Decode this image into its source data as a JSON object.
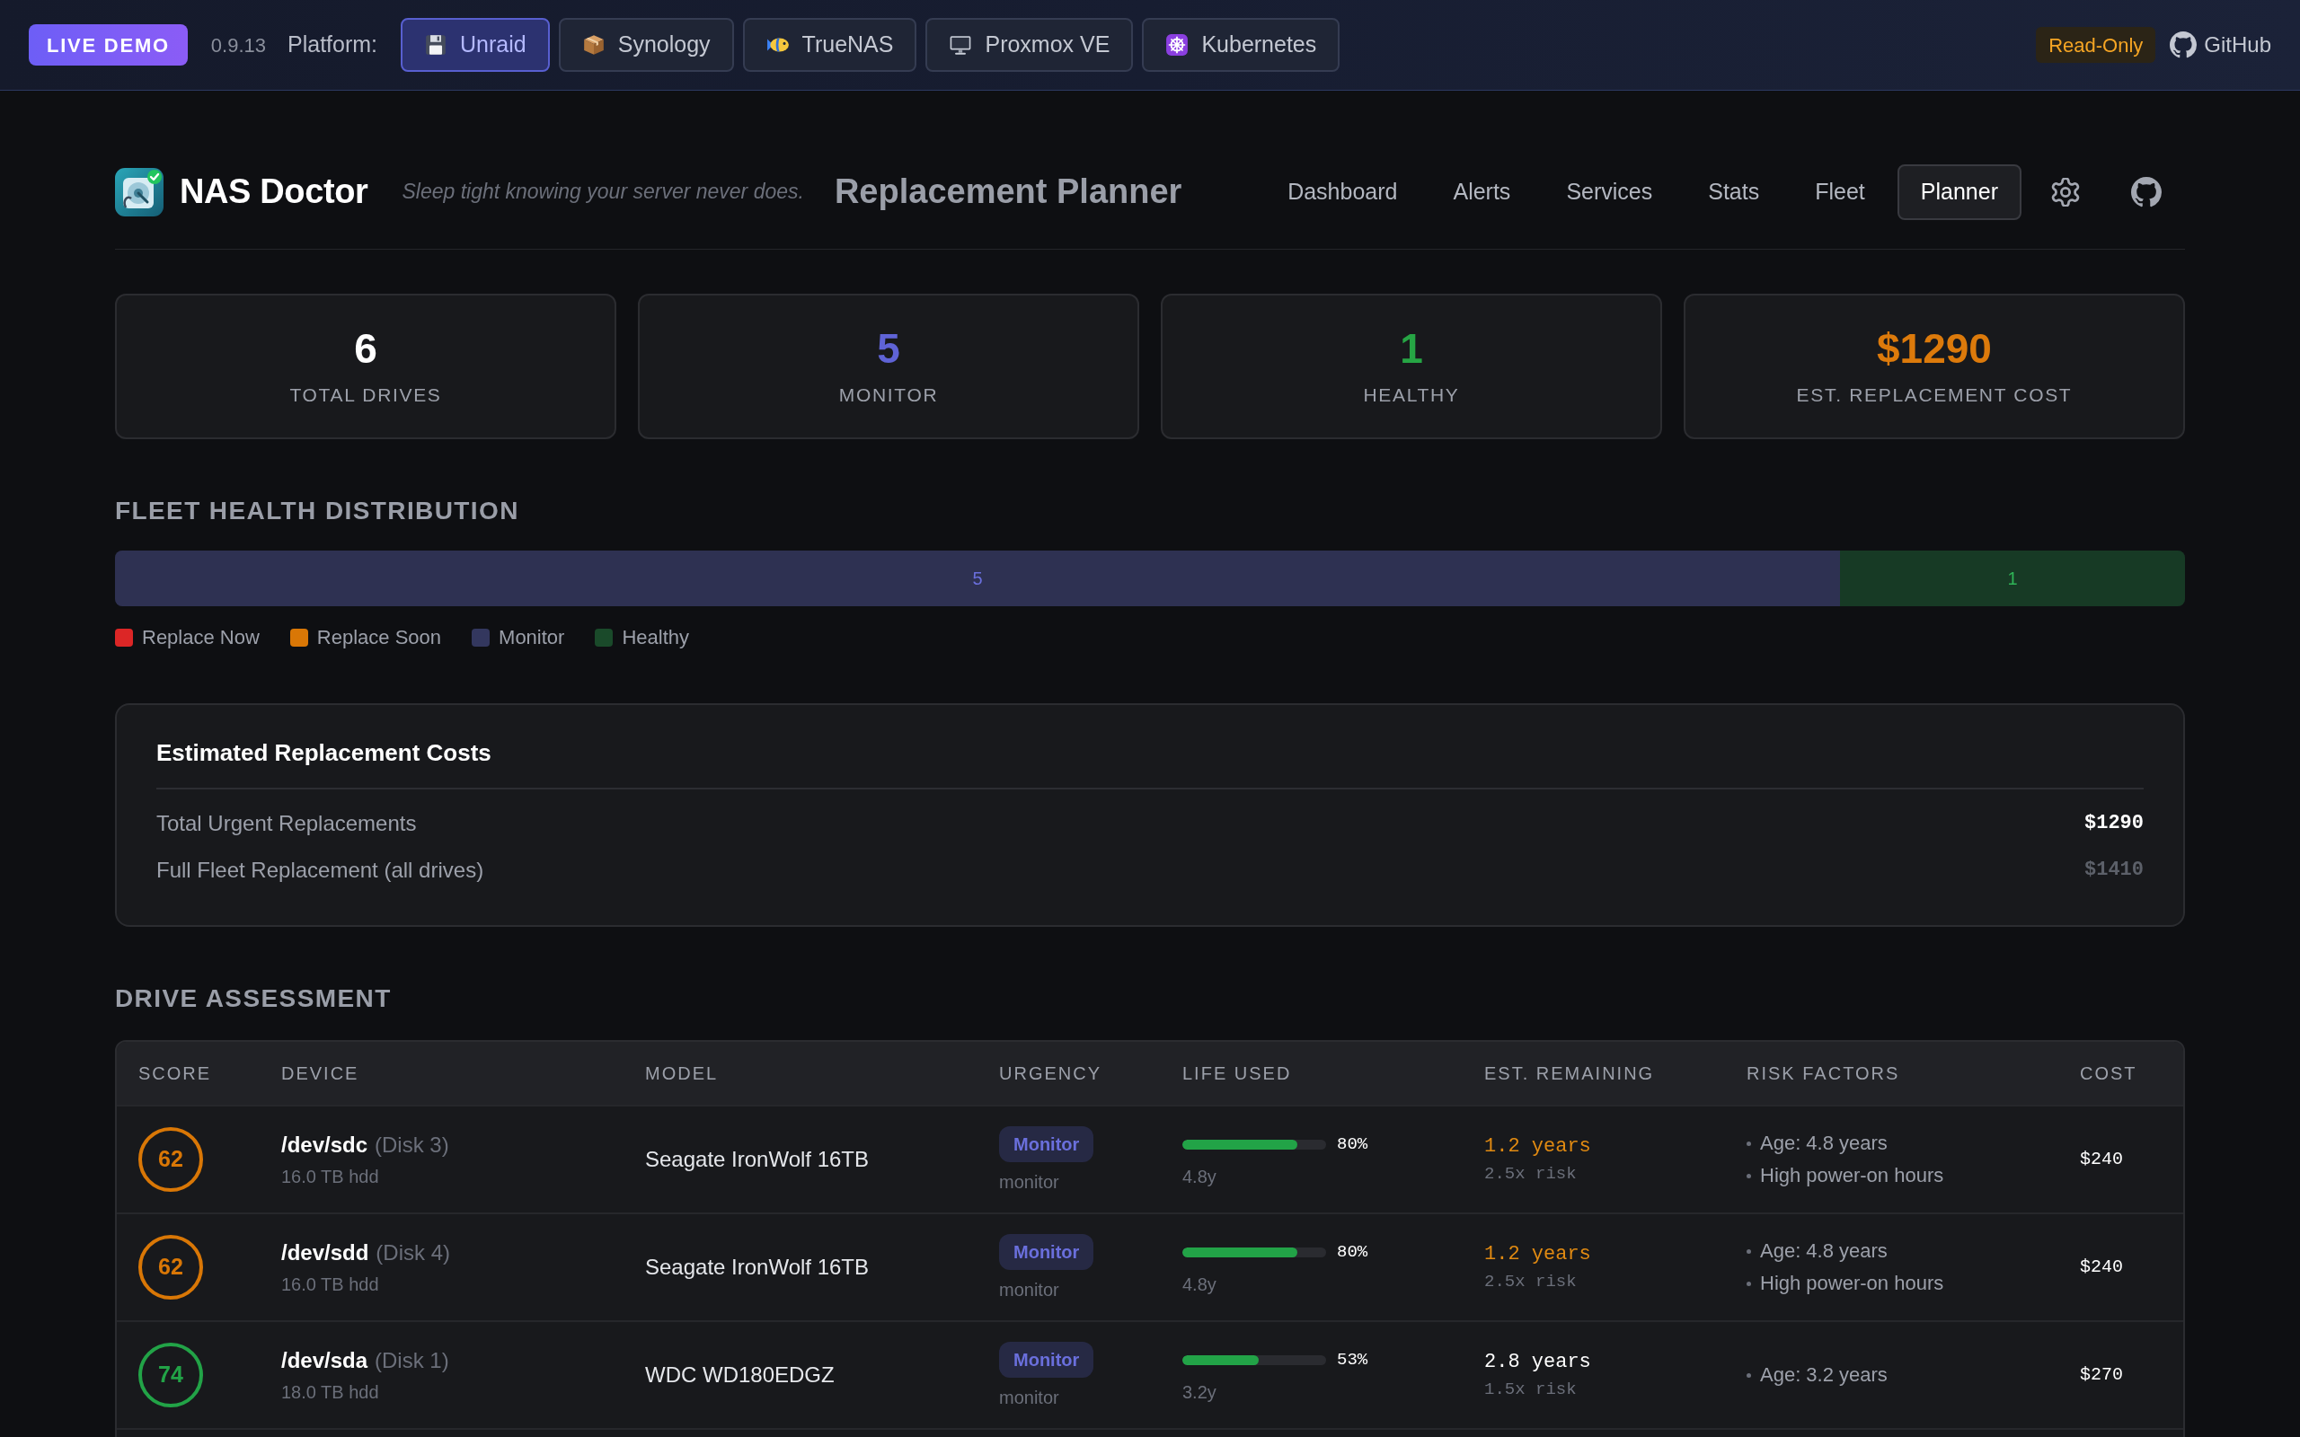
{
  "top_bar": {
    "demo_badge": "LIVE DEMO",
    "version": "0.9.13",
    "platform_label": "Platform:",
    "platforms": [
      {
        "label": "Unraid",
        "selected": true
      },
      {
        "label": "Synology",
        "selected": false
      },
      {
        "label": "TrueNAS",
        "selected": false
      },
      {
        "label": "Proxmox VE",
        "selected": false
      },
      {
        "label": "Kubernetes",
        "selected": false
      }
    ],
    "mode_badge": "Read-Only",
    "github_link": "GitHub"
  },
  "header": {
    "app_name": "NAS Doctor",
    "tagline": "Sleep tight knowing your server never does.",
    "page_title": "Replacement Planner",
    "nav": [
      {
        "label": "Dashboard",
        "selected": false
      },
      {
        "label": "Alerts",
        "selected": false
      },
      {
        "label": "Services",
        "selected": false
      },
      {
        "label": "Stats",
        "selected": false
      },
      {
        "label": "Fleet",
        "selected": false
      },
      {
        "label": "Planner",
        "selected": true
      }
    ]
  },
  "stats": [
    {
      "value": "6",
      "label": "TOTAL DRIVES",
      "color": "#ffffff"
    },
    {
      "value": "5",
      "label": "MONITOR",
      "color": "#5f63d6"
    },
    {
      "value": "1",
      "label": "HEALTHY",
      "color": "#26a544"
    },
    {
      "value": "$1290",
      "label": "EST. REPLACEMENT COST",
      "color": "#dc7a0b"
    }
  ],
  "distribution": {
    "title": "FLEET HEALTH DISTRIBUTION",
    "segments": [
      {
        "kind": "monitor",
        "value": "5",
        "level": 0.8333
      },
      {
        "kind": "healthy",
        "value": "1",
        "level": 0.1667
      }
    ],
    "legend": [
      {
        "label": "Replace Now",
        "color": "#dc2626"
      },
      {
        "label": "Replace Soon",
        "color": "#d97706"
      },
      {
        "label": "Monitor",
        "color": "#33375e"
      },
      {
        "label": "Healthy",
        "color": "#1a4a2a"
      }
    ]
  },
  "costs": {
    "title": "Estimated Replacement Costs",
    "rows": [
      {
        "label": "Total Urgent Replacements",
        "value": "$1290",
        "highlighted": true
      },
      {
        "label": "Full Fleet Replacement (all drives)",
        "value": "$1410",
        "highlighted": false
      }
    ]
  },
  "drives": {
    "title": "DRIVE ASSESSMENT",
    "columns": [
      "SCORE",
      "DEVICE",
      "MODEL",
      "URGENCY",
      "LIFE USED",
      "EST. REMAINING",
      "RISK FACTORS",
      "COST"
    ],
    "rows": [
      {
        "score": {
          "value": "62",
          "color": "#d97706"
        },
        "device": "/dev/sdc",
        "disk": "(Disk 3)",
        "capacity": "16.0 TB hdd",
        "model": "Seagate IronWolf 16TB",
        "urgency": "Monitor",
        "urgency_note": "monitor",
        "life_used": {
          "level": 0.8,
          "percent": "80%",
          "age": "4.8y"
        },
        "remaining": {
          "text": "1.2 years",
          "risk": "2.5x risk",
          "warning": true
        },
        "risk_factors": [
          "Age: 4.8 years",
          "High power-on hours"
        ],
        "cost": "$240"
      },
      {
        "score": {
          "value": "62",
          "color": "#d97706"
        },
        "device": "/dev/sdd",
        "disk": "(Disk 4)",
        "capacity": "16.0 TB hdd",
        "model": "Seagate IronWolf 16TB",
        "urgency": "Monitor",
        "urgency_note": "monitor",
        "life_used": {
          "level": 0.8,
          "percent": "80%",
          "age": "4.8y"
        },
        "remaining": {
          "text": "1.2 years",
          "risk": "2.5x risk",
          "warning": true
        },
        "risk_factors": [
          "Age: 4.8 years",
          "High power-on hours"
        ],
        "cost": "$240"
      },
      {
        "score": {
          "value": "74",
          "color": "#22a347"
        },
        "device": "/dev/sda",
        "disk": "(Disk 1)",
        "capacity": "18.0 TB hdd",
        "model": "WDC WD180EDGZ",
        "urgency": "Monitor",
        "urgency_note": "monitor",
        "life_used": {
          "level": 0.53,
          "percent": "53%",
          "age": "3.2y"
        },
        "remaining": {
          "text": "2.8 years",
          "risk": "1.5x risk",
          "warning": false
        },
        "risk_factors": [
          "Age: 3.2 years"
        ],
        "cost": "$270"
      }
    ]
  }
}
